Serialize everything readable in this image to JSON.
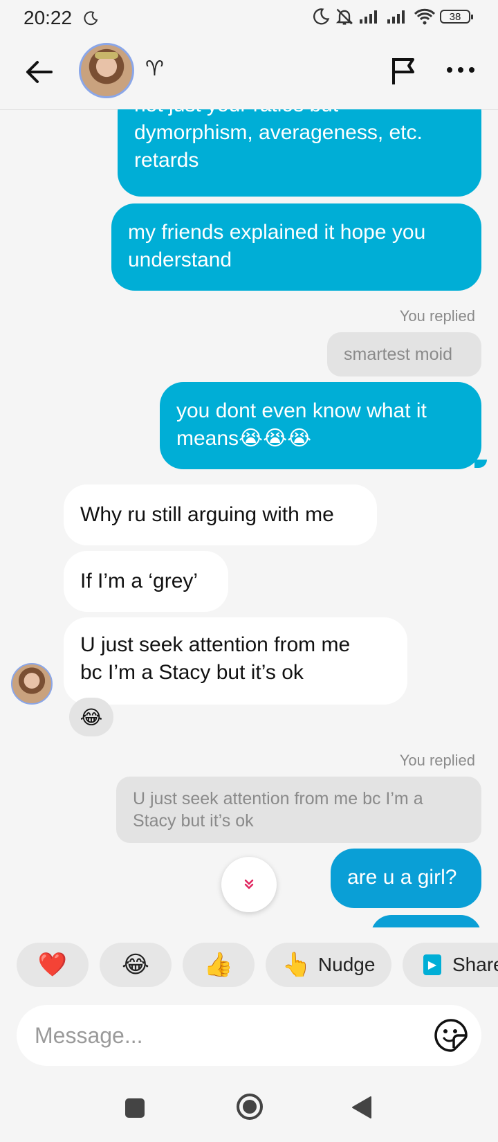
{
  "status_bar": {
    "time": "20:22",
    "battery": "38",
    "icons": [
      "moon-icon",
      "dnd-bell-off-icon",
      "signal-icon",
      "signal-icon",
      "wifi-icon",
      "battery-icon"
    ]
  },
  "header": {
    "zodiac_symbol": "♈",
    "icons": [
      "back-arrow-icon",
      "flag-icon",
      "more-icon"
    ]
  },
  "messages": {
    "m1": {
      "line1": "not just your ratios but",
      "line2": "dymorphism, averageness, etc.",
      "line3": "retards"
    },
    "m2": {
      "line1": "my friends explained it hope you",
      "line2": "understand"
    },
    "reply1": {
      "label": "You replied",
      "quote": "smartest moid"
    },
    "m3": {
      "line1": "you dont even know what it",
      "line2": "means😭😭😭"
    },
    "m4": {
      "text": "Why ru still arguing with me"
    },
    "m5": {
      "text": "If I’m a ‘grey’"
    },
    "m6": {
      "line1": "U just seek attention  from me",
      "line2": "bc I’m a Stacy but it’s ok",
      "reaction": "😂"
    },
    "reply2": {
      "label": "You replied",
      "quote_line1": "U just seek attention  from me bc I’m a",
      "quote_line2": "Stacy but it’s ok"
    },
    "m7": {
      "text": "are u a girl?"
    }
  },
  "scroll_button": {
    "glyph": "⌄⌄"
  },
  "quick_replies": [
    {
      "emoji": "❤️",
      "label": ""
    },
    {
      "emoji": "😂",
      "label": ""
    },
    {
      "emoji": "👍",
      "label": ""
    },
    {
      "emoji": "👆",
      "label": "Nudge"
    },
    {
      "emoji": "▶",
      "label": "Share"
    }
  ],
  "composer": {
    "placeholder": "Message..."
  },
  "colors": {
    "accent": "#00aed6",
    "accent_dark": "#0a9fd6",
    "background": "#f5f5f5",
    "incoming": "#ffffff"
  }
}
